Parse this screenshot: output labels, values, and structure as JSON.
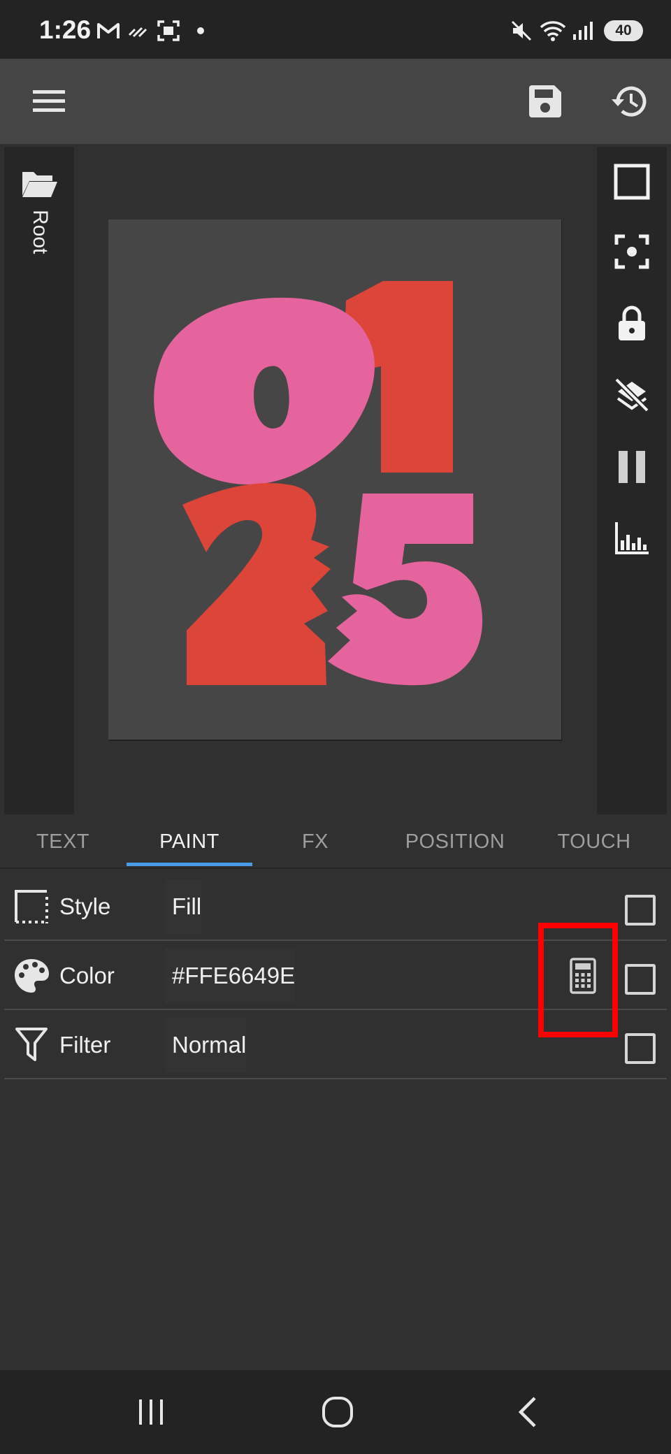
{
  "status_bar": {
    "time": "1:26",
    "battery": "40",
    "icons": [
      "gmail-icon",
      "signal-lines-icon",
      "screenshot-icon",
      "dot-icon",
      "mute-icon",
      "wifi-icon",
      "cell-signal-icon",
      "battery-icon"
    ]
  },
  "toolbar": {
    "icons": [
      "menu-icon",
      "save-icon",
      "history-icon"
    ]
  },
  "left_rail": {
    "folder_icon": "folder-open-icon",
    "root_label": "Root"
  },
  "right_rail": {
    "icons": [
      "square-outline-icon",
      "focus-center-icon",
      "lock-icon",
      "layers-off-icon",
      "pause-icon",
      "equalizer-icon"
    ]
  },
  "artboard": {
    "digits": [
      "0",
      "1",
      "2",
      "5"
    ],
    "colors": {
      "pink": "#E6649E",
      "red": "#DC4538",
      "background": "#464646"
    }
  },
  "tabs": [
    {
      "label": "TEXT",
      "active": false
    },
    {
      "label": "PAINT",
      "active": true
    },
    {
      "label": "FX",
      "active": false
    },
    {
      "label": "POSITION",
      "active": false
    },
    {
      "label": "TOUCH",
      "active": false
    }
  ],
  "properties": {
    "style": {
      "label": "Style",
      "value": "Fill",
      "icon": "dotted-border-icon"
    },
    "color": {
      "label": "Color",
      "value": "#FFE6649E",
      "icon": "palette-icon",
      "action_icon": "calculator-icon"
    },
    "filter": {
      "label": "Filter",
      "value": "Normal",
      "icon": "filter-funnel-icon"
    }
  },
  "nav_bar": {
    "icons": [
      "recents-icon",
      "home-icon",
      "back-icon"
    ]
  },
  "accent_colors": {
    "tab_indicator": "#4C9BE8",
    "highlight": "#FF0000"
  }
}
